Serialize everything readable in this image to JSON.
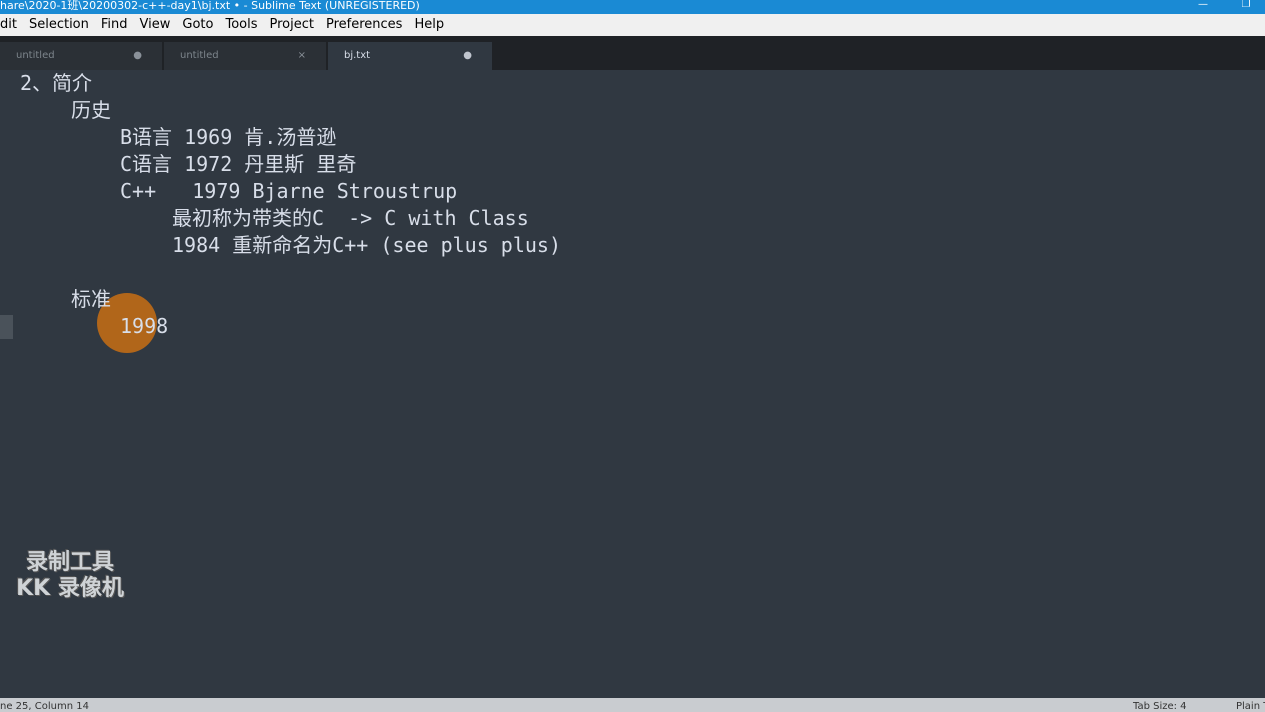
{
  "window": {
    "title": "hare\\2020-1班\\20200302-c++-day1\\bj.txt • - Sublime Text (UNREGISTERED)",
    "minimize_glyph": "—",
    "maximize_glyph": "❐"
  },
  "menu": [
    "dit",
    "Selection",
    "Find",
    "View",
    "Goto",
    "Tools",
    "Project",
    "Preferences",
    "Help"
  ],
  "tabs": [
    {
      "label": "untitled",
      "control": "●"
    },
    {
      "label": "untitled",
      "control": "×"
    },
    {
      "label": "bj.txt",
      "control": "●"
    }
  ],
  "editor": {
    "lines": [
      "2、简介",
      "历史",
      "B语言 1969 肯.汤普逊",
      "C语言 1972 丹里斯 里奇",
      "C++   1979 Bjarne Stroustrup",
      "最初称为带类的C  -> C with Class",
      "1984 重新命名为C++ (see plus plus)",
      "标准",
      "1998"
    ]
  },
  "watermark": {
    "line1": "录制工具",
    "line2": "KK 录像机"
  },
  "status": {
    "position": "ne 25, Column 14",
    "tab_size": "Tab Size: 4",
    "syntax": "Plain T"
  }
}
